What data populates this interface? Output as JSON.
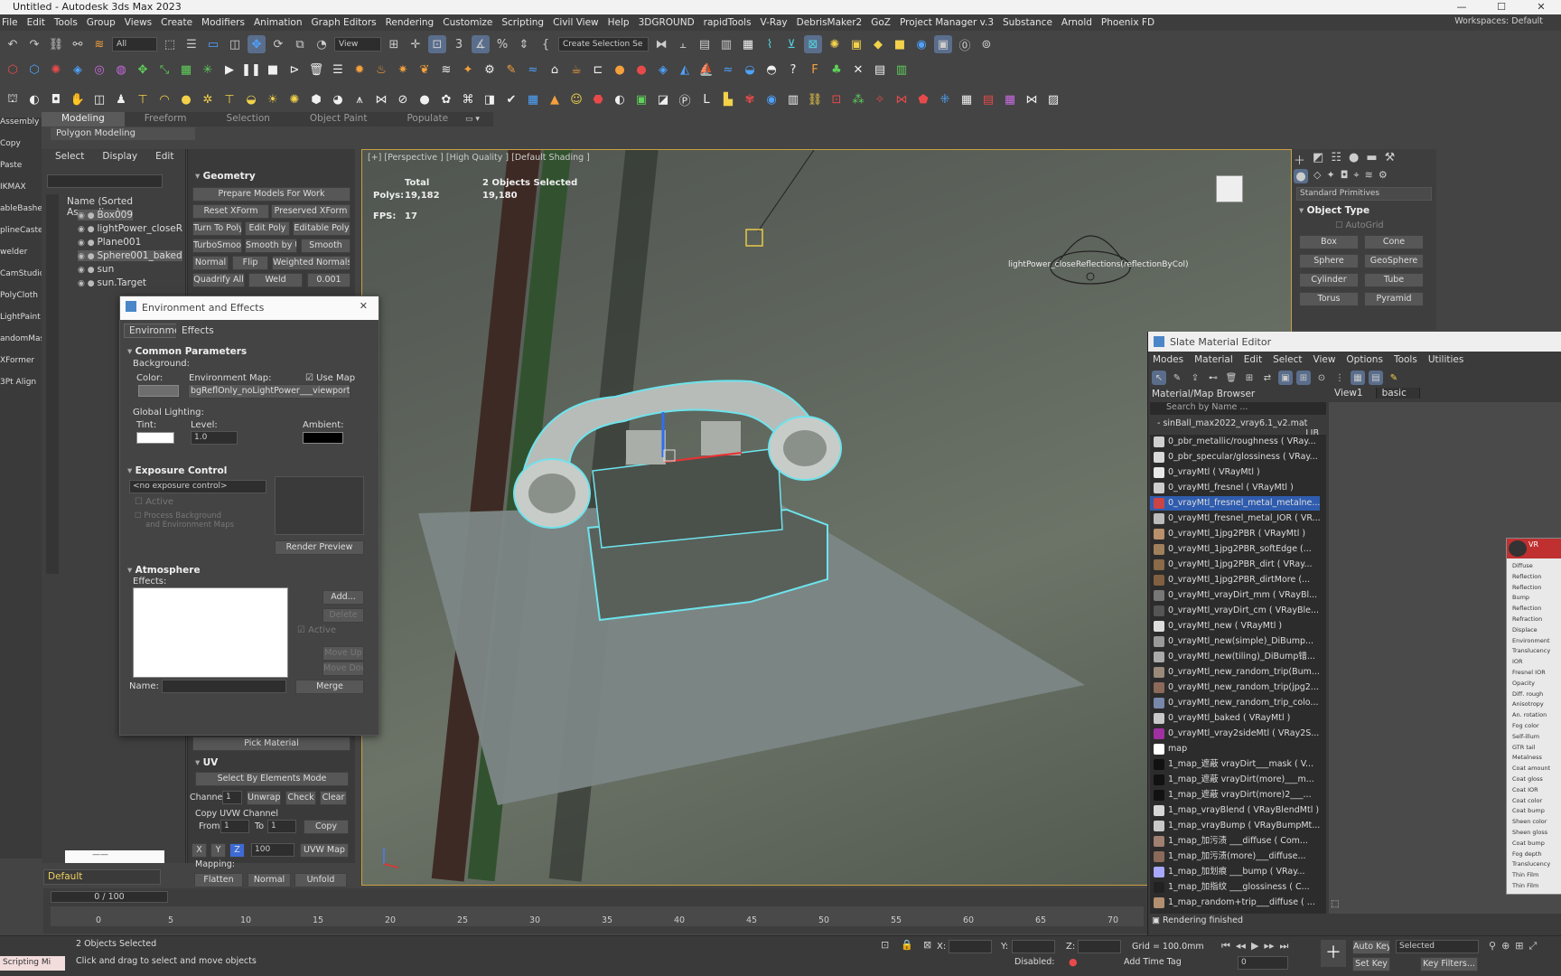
{
  "title": "Untitled - Autodesk 3ds Max 2023",
  "menu": [
    "File",
    "Edit",
    "Tools",
    "Group",
    "Views",
    "Create",
    "Modifiers",
    "Animation",
    "Graph Editors",
    "Rendering",
    "Customize",
    "Scripting",
    "Civil View",
    "Help",
    "3DGROUND",
    "rapidTools",
    "V-Ray",
    "DebrisMaker2",
    "GoZ",
    "Project Manager v.3",
    "Substance",
    "Arnold",
    "Phoenix FD"
  ],
  "workspace": "Workspaces: Default",
  "toolbar": {
    "filter": "All",
    "view": "View",
    "create_selection": "Create Selection Se"
  },
  "ribbon_tabs": [
    "Modeling",
    "Freeform",
    "Selection",
    "Object Paint",
    "Populate"
  ],
  "ribbon_sub": "Polygon Modeling",
  "left_strip": [
    "Assembly",
    "Copy",
    "Paste",
    "IKMAX",
    "ableBasher",
    "plineCaster",
    "welder",
    "CamStudio",
    "PolyCloth",
    "LightPaint",
    "andomMas",
    "XFormer",
    "3Pt Align"
  ],
  "scene": {
    "tabs": [
      "Select",
      "Display",
      "Edit"
    ],
    "header": "Name (Sorted Ascending)",
    "items": [
      "Box009",
      "lightPower_closeR",
      "Plane001",
      "Sphere001_baked",
      "sun",
      "sun.Target"
    ],
    "layer": "Default"
  },
  "geometry": {
    "title": "Geometry",
    "buttons": [
      "Prepare Models For Work",
      "Reset XForm",
      "Preserved XForm",
      "Turn To Poly",
      "Edit Poly",
      "Editable Poly",
      "TurboSmooth",
      "Smooth by UV",
      "Smooth",
      "Normal",
      "Flip",
      "Weighted Normals",
      "Quadrify All",
      "Weld",
      "0.001"
    ]
  },
  "uv": {
    "title": "UV",
    "select_mode": "Select By Elements Mode",
    "channel_label": "Channel",
    "channel": "1",
    "unwrap": "Unwrap",
    "check": "Check",
    "clear": "Clear",
    "copy_label": "Copy UVW Channel",
    "from_label": "From",
    "from": "1",
    "to_label": "To",
    "to": "1",
    "copy": "Copy",
    "axes": [
      "X",
      "Y",
      "Z"
    ],
    "size": "100",
    "uvw_map": "UVW Map",
    "mapping_label": "Mapping:",
    "flatten": "Flatten",
    "normal": "Normal",
    "unfold": "Unfold"
  },
  "pick_material": "Pick Material",
  "viewport": {
    "label": "[+] [Perspective ] [High Quality ] [Default Shading ]",
    "total_label": "Total",
    "selected_label": "2 Objects Selected",
    "polys_label": "Polys:",
    "polys_total": "19,182",
    "polys_selected": "19,180",
    "fps_label": "FPS:",
    "fps": "17",
    "light_label": "lightPower_closeReflections(reflectionByCol)"
  },
  "env": {
    "title": "Environment and Effects",
    "tabs": [
      "Environment",
      "Effects"
    ],
    "common": "Common Parameters",
    "background": "Background:",
    "color": "Color:",
    "env_map": "Environment Map:",
    "use_map": "Use Map",
    "map_name": "bgReflOnly_noLightPower___viewport/rende",
    "global_lighting": "Global Lighting:",
    "tint": "Tint:",
    "level": "Level:",
    "level_value": "1.0",
    "ambient": "Ambient:",
    "exposure": "Exposure Control",
    "exposure_value": "<no exposure control>",
    "active": "Active",
    "process_bg": "Process Background",
    "process_bg2": "and Environment Maps",
    "render_preview": "Render Preview",
    "atmosphere": "Atmosphere",
    "effects": "Effects:",
    "add": "Add...",
    "delete": "Delete",
    "active2": "Active",
    "move_up": "Move Up",
    "move_down": "Move Down",
    "name_label": "Name:",
    "merge": "Merge"
  },
  "command_panel": {
    "dropdown": "Standard Primitives",
    "object_type": "Object Type",
    "autogrid": "AutoGrid",
    "buttons": [
      "Box",
      "Cone",
      "Sphere",
      "GeoSphere",
      "Cylinder",
      "Tube",
      "Torus",
      "Pyramid"
    ]
  },
  "slate": {
    "title": "Slate Material Editor",
    "menu": [
      "Modes",
      "Material",
      "Edit",
      "Select",
      "View",
      "Options",
      "Tools",
      "Utilities"
    ],
    "browser_title": "Material/Map Browser",
    "search_placeholder": "Search by Name ...",
    "library": "sinBall_max2022_vray6.1_v2.mat",
    "library_tag": "LIB",
    "tabs": [
      "View1",
      "basic"
    ],
    "status": "Rendering finished",
    "materials": [
      "0_pbr_metallic/roughness ( VRay...",
      "0_pbr_specular/glossiness ( VRay...",
      "0_vrayMtl ( VRayMtl )",
      "0_vrayMtl_fresnel ( VRayMtl )",
      "0_vrayMtl_fresnel_metal_metalne...",
      "0_vrayMtl_fresnel_metal_IOR ( VR...",
      "0_vrayMtl_1jpg2PBR ( VRayMtl )",
      "0_vrayMtl_1jpg2PBR_softEdge (...",
      "0_vrayMtl_1jpg2PBR_dirt ( VRay...",
      "0_vrayMtl_1jpg2PBR_dirtMore (...",
      "0_vrayMtl_vrayDirt_mm ( VRayBl...",
      "0_vrayMtl_vrayDirt_cm ( VRayBle...",
      "0_vrayMtl_new ( VRayMtl )",
      "0_vrayMtl_new(simple)_DiBump...",
      "0_vrayMtl_new(tiling)_DiBump错...",
      "0_vrayMtl_new_random_trip(Bum...",
      "0_vrayMtl_new_random_trip(jpg2...",
      "0_vrayMtl_new_random_trip_colo...",
      "0_vrayMtl_baked ( VRayMtl )",
      "0_vrayMtl_vray2sideMtl ( VRay2S...",
      "map",
      "1_map_遮蔽 vrayDirt___mask ( V...",
      "1_map_遮蔽 vrayDirt(more)___m...",
      "1_map_遮蔽 vrayDirt(more)2___...",
      "1_map_vrayBlend ( VRayBlendMtl )",
      "1_map_vrayBump ( VRayBumpMt...",
      "1_map_加污渍 ___diffuse ( Com...",
      "1_map_加污渍(more)___diffuse...",
      "1_map_加划痕 ___bump ( VRay...",
      "1_map_加指纹 ___glossiness ( C...",
      "1_map_random+trip___diffuse ( ..."
    ],
    "swatches": [
      "#cfcfcf",
      "#d9d9d9",
      "#e8e8e8",
      "#cccccc",
      "#c44",
      "#bbb",
      "#b8906c",
      "#a0805c",
      "#8a6a48",
      "#806040",
      "#777",
      "#555",
      "#ddd",
      "#999",
      "#aaa",
      "#9b8a7a",
      "#8b6a5a",
      "#7788aa",
      "#c8c8c8",
      "#a030a0",
      "#ffffff",
      "#111",
      "#111",
      "#111",
      "#d6d6d6",
      "#c8c8c8",
      "#a08070",
      "#8a6a5a",
      "#a8a8ff",
      "#222",
      "#b09070"
    ],
    "node_params": [
      "Diffuse",
      "Reflection",
      "Reflection",
      "Bump",
      "Reflection",
      "Refraction",
      "Displace",
      "Environment",
      "Translucency",
      "IOR",
      "Fresnel IOR",
      "Opacity",
      "Diff. rough",
      "Anisotropy",
      "An. rotation",
      "Fog color",
      "Self-illum",
      "GTR tail",
      "Metalness",
      "Coat amount",
      "Coat gloss",
      "Coat IOR",
      "Coat color",
      "Coat bump",
      "Sheen color",
      "Sheen gloss",
      "Coat bump",
      "Fog depth",
      "Translucency",
      "Thin Film",
      "Thin Film"
    ]
  },
  "timeline": {
    "frame": "0 / 100",
    "ticks": [
      "0",
      "5",
      "10",
      "15",
      "20",
      "25",
      "30",
      "35",
      "40",
      "45",
      "50",
      "55",
      "60",
      "65",
      "70"
    ]
  },
  "status": {
    "script": "Scripting Mi",
    "selected": "2 Objects Selected",
    "prompt": "Click and drag to select and move objects",
    "x_label": "X:",
    "y_label": "Y:",
    "z_label": "Z:",
    "grid": "Grid = 100.0mm",
    "disabled": "Disabled:",
    "add_time_tag": "Add Time Tag",
    "frame": "0",
    "auto_key": "Auto Key",
    "set_key": "Set Key",
    "selected_dd": "Selected",
    "key_filters": "Key Filters..."
  }
}
